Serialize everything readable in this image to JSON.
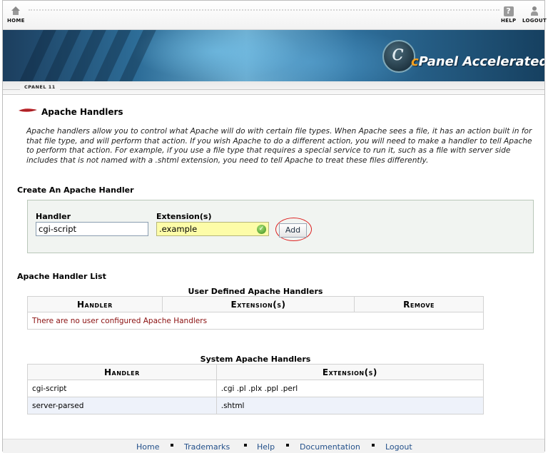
{
  "topnav": {
    "home_label": "HOME",
    "help_label": "HELP",
    "logout_label": "LOGOUT"
  },
  "banner": {
    "logo_c": "c",
    "logo_panel": "Panel",
    "logo_accel": " Accelerated"
  },
  "breadcrumb": "CPANEL 11",
  "page": {
    "title": "Apache Handlers",
    "description": "Apache handlers allow you to control what Apache will do with certain file types. When Apache sees a file, it has an action built in for that file type, and will perform that action. If you wish Apache to do a different action, you will need to make a handler to tell Apache to perform that action. For example, if you use a file type that requires a special service to run it, such as a file with server side includes that is not named with a .shtml extension, you need to tell Apache to treat these files differently."
  },
  "create_form": {
    "heading": "Create An Apache Handler",
    "handler_label": "Handler",
    "handler_value": "cgi-script",
    "extension_label": "Extension(s)",
    "extension_value": ".example",
    "add_label": "Add"
  },
  "list": {
    "heading": "Apache Handler List",
    "user_table": {
      "caption": "User Defined Apache Handlers",
      "col_handler": "Handler",
      "col_extension": "Extension(s)",
      "col_remove": "Remove",
      "empty_message": "There are no user configured Apache Handlers"
    },
    "system_table": {
      "caption": "System Apache Handlers",
      "col_handler": "Handler",
      "col_extension": "Extension(s)",
      "rows": [
        {
          "handler": "cgi-script",
          "extensions": ".cgi .pl .plx .ppl .perl"
        },
        {
          "handler": "server-parsed",
          "extensions": ".shtml"
        }
      ]
    }
  },
  "footer": {
    "links": [
      "Home",
      "Trademarks",
      "Help",
      "Documentation",
      "Logout"
    ]
  },
  "colors": {
    "accent_ring": "#dd2222",
    "empty_text": "#8b1010",
    "link": "#23508a"
  }
}
